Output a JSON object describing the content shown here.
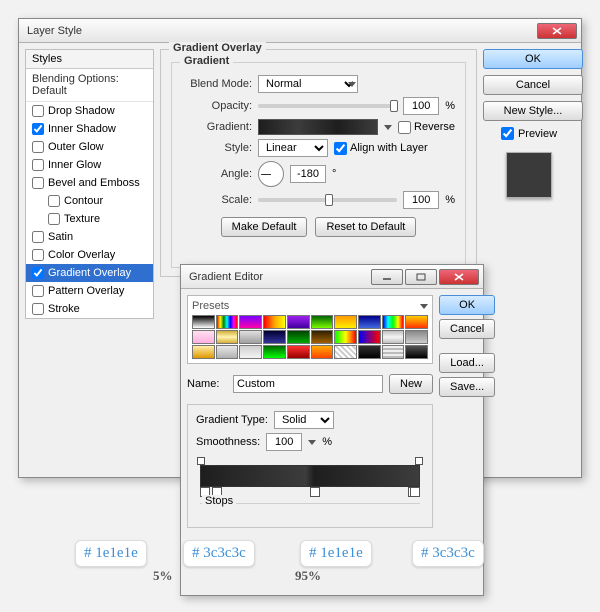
{
  "dialog": {
    "title": "Layer Style"
  },
  "buttons": {
    "ok": "OK",
    "cancel": "Cancel",
    "newStyle": "New Style...",
    "preview": "Preview",
    "makeDefault": "Make Default",
    "resetDefault": "Reset to Default",
    "load": "Load...",
    "save": "Save...",
    "new": "New"
  },
  "stylesPanel": {
    "head": "Styles",
    "blending": "Blending Options: Default",
    "items": [
      {
        "label": "Drop Shadow",
        "checked": false
      },
      {
        "label": "Inner Shadow",
        "checked": true
      },
      {
        "label": "Outer Glow",
        "checked": false
      },
      {
        "label": "Inner Glow",
        "checked": false
      },
      {
        "label": "Bevel and Emboss",
        "checked": false
      },
      {
        "label": "Contour",
        "checked": false,
        "indent": true
      },
      {
        "label": "Texture",
        "checked": false,
        "indent": true
      },
      {
        "label": "Satin",
        "checked": false
      },
      {
        "label": "Color Overlay",
        "checked": false
      },
      {
        "label": "Gradient Overlay",
        "checked": true,
        "selected": true
      },
      {
        "label": "Pattern Overlay",
        "checked": false
      },
      {
        "label": "Stroke",
        "checked": false
      }
    ]
  },
  "group": {
    "title": "Gradient Overlay",
    "sub": "Gradient",
    "blendMode": {
      "label": "Blend Mode:",
      "value": "Normal"
    },
    "opacity": {
      "label": "Opacity:",
      "value": "100",
      "unit": "%",
      "pos": 95
    },
    "gradient": {
      "label": "Gradient:",
      "reverse": "Reverse"
    },
    "style": {
      "label": "Style:",
      "value": "Linear",
      "align": "Align with Layer",
      "alignChecked": true
    },
    "angle": {
      "label": "Angle:",
      "value": "-180",
      "unit": "°"
    },
    "scale": {
      "label": "Scale:",
      "value": "100",
      "unit": "%",
      "pos": 48
    }
  },
  "ged": {
    "title": "Gradient Editor",
    "presets": "Presets",
    "nameLabel": "Name:",
    "nameValue": "Custom",
    "typeLabel": "Gradient Type:",
    "typeValue": "Solid",
    "smoothLabel": "Smoothness:",
    "smoothValue": "100",
    "smoothUnit": "%",
    "stops": "Stops",
    "swatches": [
      "linear-gradient(#000,#fff)",
      "linear-gradient(90deg,red,yellow,green,cyan,blue,magenta,red)",
      "linear-gradient(#7a00ff,#ff00aa)",
      "linear-gradient(90deg,red,orange,yellow)",
      "linear-gradient(#a020f0,#4000a0)",
      "linear-gradient(#006400,#7cfc00)",
      "linear-gradient(#ff9900,#ffee00)",
      "linear-gradient(#00008b,#4169e1)",
      "linear-gradient(90deg,#00f,#0ff,#0f0,#ff0,#f00)",
      "linear-gradient(#ffcc00,#ff3300)",
      "linear-gradient(#ffe0f0,#ffb0e0)",
      "linear-gradient(#d4af37,#fff3b0,#d4af37)",
      "linear-gradient(#e0e0e0,#a0a0a0)",
      "linear-gradient(#003,#339)",
      "linear-gradient(#004400,#00aa00)",
      "linear-gradient(#302000,#a06000)",
      "linear-gradient(90deg,#0f0,#ff0,#f00)",
      "linear-gradient(90deg,#00f,#f00)",
      "linear-gradient(#c0c0c0,#f5f5f5,#c0c0c0)",
      "linear-gradient(#888,#ccc)",
      "linear-gradient(#ffeeaa,#dd9900)",
      "linear-gradient(#e8e8e8,#b0b0b0)",
      "linear-gradient(#cfcfcf,#f4f4f4)",
      "linear-gradient(#006600,#00ff00)",
      "linear-gradient(#ff3333,#990000)",
      "linear-gradient(#ffaa00,#ff4400)",
      "repeating-linear-gradient(45deg,#ccc,#ccc 2px,#fff 2px,#fff 4px)",
      "linear-gradient(#303030,#000)",
      "repeating-linear-gradient(0deg,#bbb,#bbb 2px,#eee 2px,#eee 4px)",
      "linear-gradient(#555,#000)"
    ]
  },
  "callouts": {
    "c1": "# 1e1e1e",
    "c2": "# 3c3c3c",
    "c3": "# 1e1e1e",
    "c4": "# 3c3c3c",
    "p1": "5%",
    "p2": "95%"
  }
}
